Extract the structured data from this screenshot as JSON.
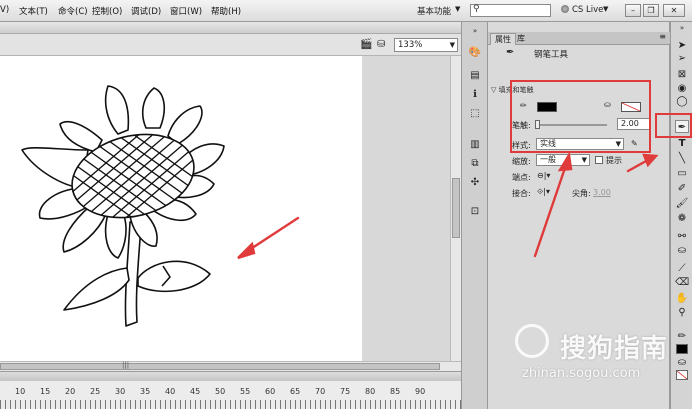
{
  "menubar": {
    "items": [
      "V)",
      "文本(T)",
      "命令(C)",
      "控制(O)",
      "调试(D)",
      "窗口(W)",
      "帮助(H)"
    ],
    "workspace": "基本功能",
    "search_value": "",
    "cslive": "CS Live"
  },
  "edit_toolbar": {
    "zoom": "133%"
  },
  "panel": {
    "tab_properties": "属性",
    "tab_library": "库",
    "tool_name": "钢笔工具",
    "section_title": "填充和笔触",
    "stroke_label": "笔触:",
    "stroke_value": "2.00",
    "style_label": "样式:",
    "style_value": "实线",
    "scale_label": "缩放:",
    "scale_value": "一般",
    "hint_label": "提示",
    "cap_label": "端点:",
    "join_label": "接合:",
    "miter_label": "尖角:",
    "miter_value": "3.00",
    "stroke_color": "#000000",
    "fill_color": "none"
  },
  "timeline": {
    "ruler_labels": [
      "10",
      "15",
      "20",
      "25",
      "30",
      "35",
      "40",
      "45",
      "50",
      "55",
      "60",
      "65",
      "70",
      "75",
      "80",
      "85",
      "90"
    ]
  },
  "tools": [
    "selection-arrow",
    "subselection-arrow",
    "lasso",
    "3d-rotation",
    "free-transform",
    "pen",
    "text",
    "line",
    "rectangle",
    "pencil",
    "brush",
    "deco",
    "bone",
    "paint-bucket",
    "eyedropper",
    "eraser",
    "hand",
    "zoom",
    "stroke-color",
    "fill-color"
  ],
  "watermark": {
    "brand": "搜狗指南",
    "url": "zhinan.sogou.com"
  },
  "colors": {
    "annotation": "#e03b3b",
    "canvas": "#ffffff"
  }
}
